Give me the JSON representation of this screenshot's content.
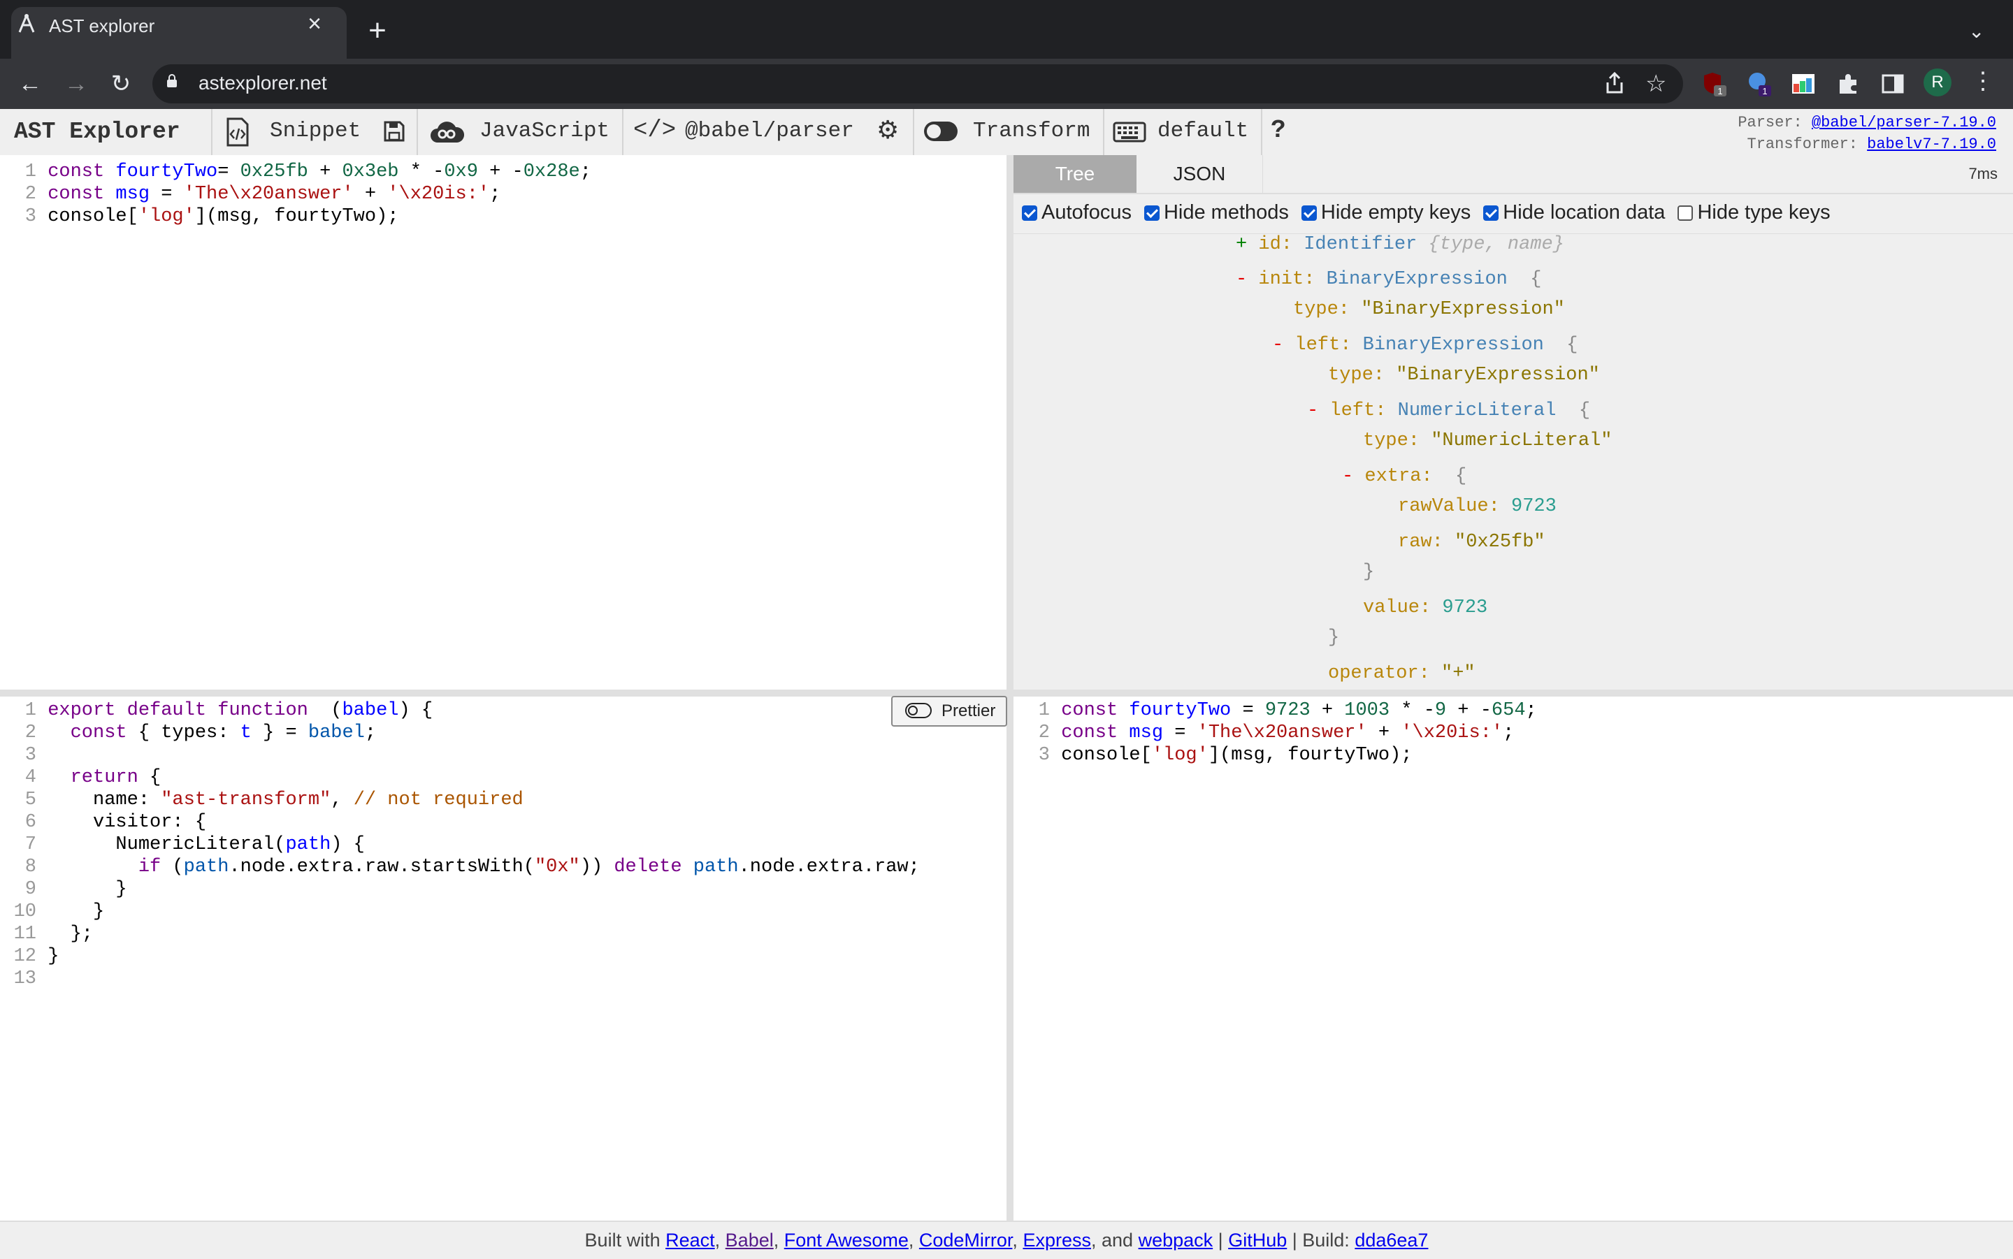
{
  "browser": {
    "tab_title": "AST explorer",
    "url": "astexplorer.net"
  },
  "appbar": {
    "brand": "AST Explorer",
    "snippet": "Snippet",
    "language": "JavaScript",
    "parser": "@babel/parser",
    "transform": "Transform",
    "keymap": "default",
    "help": "?",
    "parser_label": "Parser:",
    "parser_link": "@babel/parser-7.19.0",
    "transformer_label": "Transformer:",
    "transformer_link": "babelv7-7.19.0"
  },
  "source_code": [
    {
      "n": "1",
      "parts": [
        [
          "kw",
          "const "
        ],
        [
          "def",
          "fourtyTwo"
        ],
        [
          "",
          "= "
        ],
        [
          "num",
          "0x25fb"
        ],
        [
          "",
          " + "
        ],
        [
          "num",
          "0x3eb"
        ],
        [
          "",
          " * -"
        ],
        [
          "num",
          "0x9"
        ],
        [
          "",
          " + -"
        ],
        [
          "num",
          "0x28e"
        ],
        [
          "",
          ";"
        ]
      ]
    },
    {
      "n": "2",
      "parts": [
        [
          "kw",
          "const "
        ],
        [
          "def",
          "msg"
        ],
        [
          "",
          " = "
        ],
        [
          "str",
          "'The\\x20answer'"
        ],
        [
          "",
          " + "
        ],
        [
          "str",
          "'\\x20is:'"
        ],
        [
          "",
          ";"
        ]
      ]
    },
    {
      "n": "3",
      "parts": [
        [
          "",
          "console["
        ],
        [
          "str",
          "'log'"
        ],
        [
          "",
          "](msg, fourtyTwo);"
        ]
      ]
    }
  ],
  "tree": {
    "tabs": [
      "Tree",
      "JSON"
    ],
    "time": "7ms",
    "options": [
      {
        "label": "Autofocus",
        "checked": true
      },
      {
        "label": "Hide methods",
        "checked": true
      },
      {
        "label": "Hide empty keys",
        "checked": true
      },
      {
        "label": "Hide location data",
        "checked": true
      },
      {
        "label": "Hide type keys",
        "checked": false
      }
    ]
  },
  "transform_code": [
    {
      "n": "1",
      "parts": [
        [
          "kw",
          "export default function "
        ],
        [
          "",
          " ("
        ],
        [
          "def",
          "babel"
        ],
        [
          "",
          ") {"
        ]
      ]
    },
    {
      "n": "2",
      "parts": [
        [
          "",
          "  "
        ],
        [
          "kw",
          "const"
        ],
        [
          "",
          " { types: "
        ],
        [
          "def",
          "t"
        ],
        [
          "",
          " } = "
        ],
        [
          "var2",
          "babel"
        ],
        [
          "",
          ";"
        ]
      ]
    },
    {
      "n": "3",
      "parts": []
    },
    {
      "n": "4",
      "parts": [
        [
          "",
          "  "
        ],
        [
          "kw",
          "return"
        ],
        [
          "",
          " {"
        ]
      ]
    },
    {
      "n": "5",
      "parts": [
        [
          "",
          "    name: "
        ],
        [
          "str",
          "\"ast-transform\""
        ],
        [
          "",
          ", "
        ],
        [
          "cmt",
          "// not required"
        ]
      ]
    },
    {
      "n": "6",
      "parts": [
        [
          "",
          "    visitor: {"
        ]
      ]
    },
    {
      "n": "7",
      "parts": [
        [
          "",
          "      NumericLiteral("
        ],
        [
          "def",
          "path"
        ],
        [
          "",
          ") {"
        ]
      ]
    },
    {
      "n": "8",
      "parts": [
        [
          "",
          "        "
        ],
        [
          "kw",
          "if"
        ],
        [
          "",
          " ("
        ],
        [
          "var2",
          "path"
        ],
        [
          "",
          ".node.extra.raw.startsWith("
        ],
        [
          "str",
          "\"0x\""
        ],
        [
          "",
          "))"
        ],
        [
          "kw",
          " delete "
        ],
        [
          "var2",
          "path"
        ],
        [
          "",
          ".node.extra.raw;"
        ]
      ]
    },
    {
      "n": "9",
      "parts": [
        [
          "",
          "      }"
        ]
      ]
    },
    {
      "n": "10",
      "parts": [
        [
          "",
          "    }"
        ]
      ]
    },
    {
      "n": "11",
      "parts": [
        [
          "",
          "  };"
        ]
      ]
    },
    {
      "n": "12",
      "parts": [
        [
          "",
          "}"
        ]
      ]
    },
    {
      "n": "13",
      "parts": []
    }
  ],
  "prettier_label": "Prettier",
  "output_code": [
    {
      "n": "1",
      "parts": [
        [
          "kw",
          "const "
        ],
        [
          "def",
          "fourtyTwo"
        ],
        [
          "",
          " = "
        ],
        [
          "num",
          "9723"
        ],
        [
          "",
          " + "
        ],
        [
          "num",
          "1003"
        ],
        [
          "",
          " * -"
        ],
        [
          "num",
          "9"
        ],
        [
          "",
          " + -"
        ],
        [
          "num",
          "654"
        ],
        [
          "",
          ";"
        ]
      ]
    },
    {
      "n": "2",
      "parts": [
        [
          "kw",
          "const "
        ],
        [
          "def",
          "msg"
        ],
        [
          "",
          " = "
        ],
        [
          "str",
          "'The\\x20answer'"
        ],
        [
          "",
          " + "
        ],
        [
          "str",
          "'\\x20is:'"
        ],
        [
          "",
          ";"
        ]
      ]
    },
    {
      "n": "3",
      "parts": [
        [
          "",
          "console["
        ],
        [
          "str",
          "'log'"
        ],
        [
          "",
          "](msg, fourtyTwo);"
        ]
      ]
    }
  ],
  "footer": {
    "built_with": "Built with",
    "links": [
      "React",
      "Babel",
      "Font Awesome",
      "CodeMirror",
      "Express",
      "webpack"
    ],
    "and": "and",
    "github": "GitHub",
    "build_label": "Build:",
    "build_hash": "dda6ea7"
  },
  "colors": {
    "accent": "#0b57d0",
    "chrome_dark": "#202124",
    "chrome_mid": "#35363a"
  }
}
